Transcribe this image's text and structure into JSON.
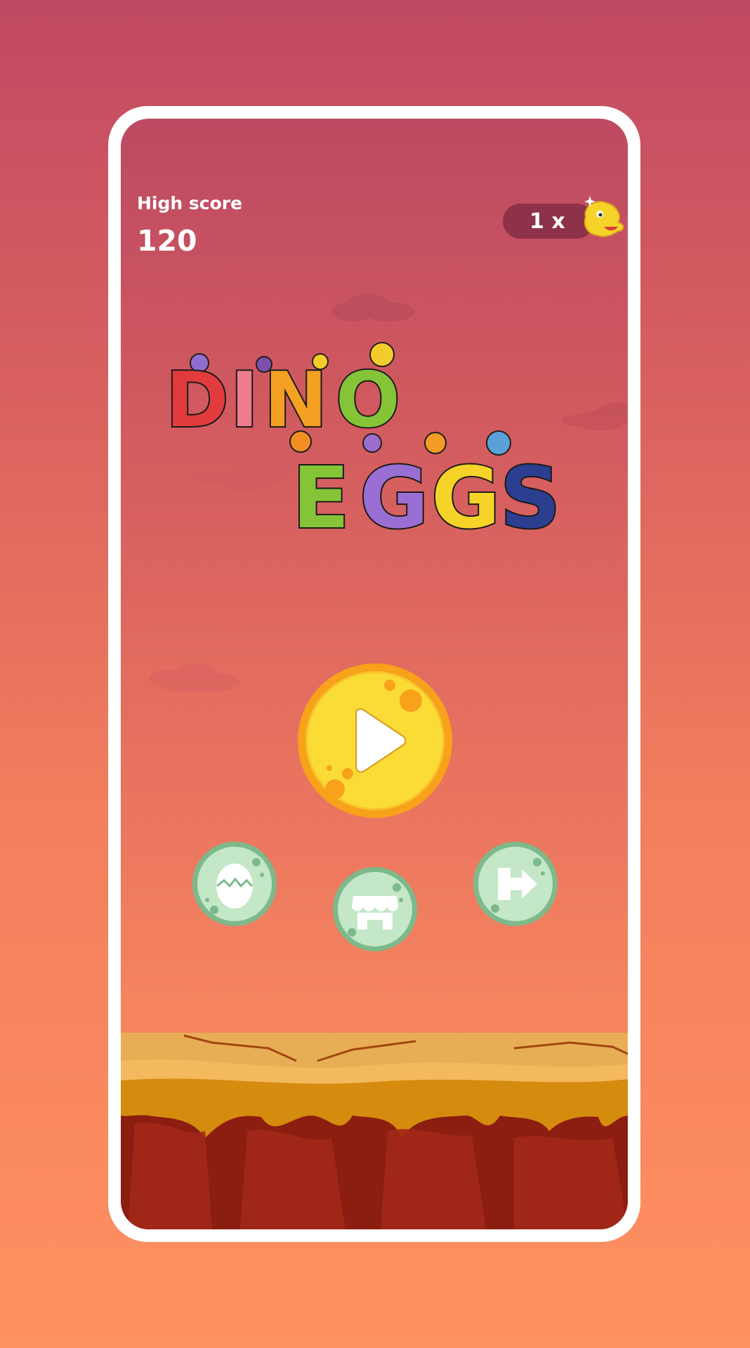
{
  "high_score": {
    "label": "High score",
    "value": "120"
  },
  "lives": {
    "text": "1 x",
    "icon": "dino-head-icon"
  },
  "title": {
    "line1": "DINO",
    "line2": "EGGS",
    "letter_colors": [
      "#e23b3d",
      "#ee7c8e",
      "#f4a022",
      "#85c437",
      "#9a6fd3",
      "#f6d329",
      "#2b3e8f"
    ]
  },
  "buttons": {
    "play_icon": "play-icon",
    "collection_icon": "egg-icon",
    "shop_icon": "shop-icon",
    "exit_icon": "exit-icon"
  },
  "colors": {
    "frame": "#ffffff",
    "play_fill": "#fbdc36",
    "play_ring": "#f8a11b",
    "secondary_fill": "#c3e7c7",
    "secondary_ring": "#7db98b"
  }
}
